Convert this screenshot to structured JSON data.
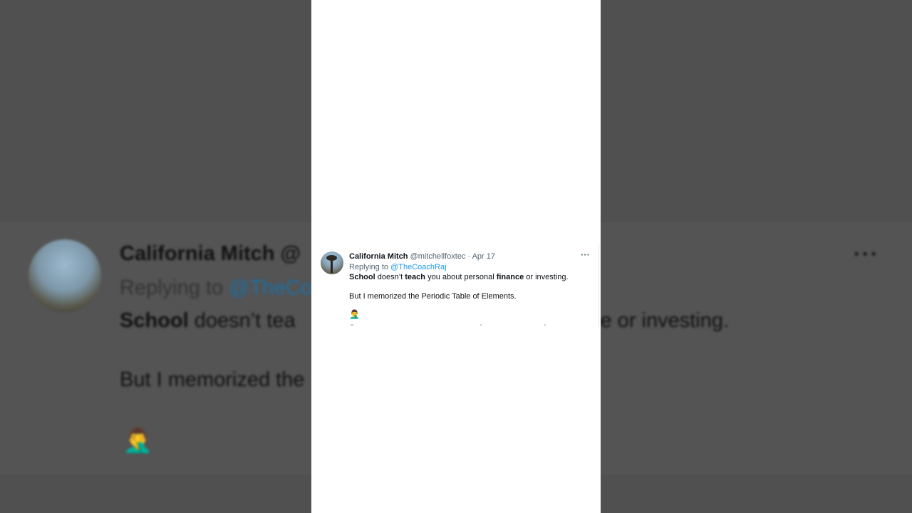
{
  "tweet": {
    "display_name": "California Mitch",
    "handle": "@mitchellfoxtec",
    "separator": " · ",
    "date": "Apr 17",
    "more_label": "···",
    "replying_prefix": "Replying to ",
    "replying_to": "@TheCoachRaj",
    "line1": {
      "w1": "School",
      "t1": " doesn’t ",
      "w2": "teach",
      "t2": " you about personal ",
      "w3": "finance",
      "t3": " or investing."
    },
    "line2": "But I memorized the Periodic Table of Elements.",
    "emoji": "🤦‍♂️"
  },
  "background": {
    "name_fragment": "California Mitch @",
    "reply_prefix": "Replying to ",
    "reply_fragment": "@TheCo",
    "line1_start_bold": "School",
    "line1_start_rest": " doesn’t tea",
    "line1_end": "ce or investing.",
    "line2_fragment": "But I memorized the",
    "more_label": "···"
  },
  "colors": {
    "link": "#1d9bf0",
    "text": "#0f1419",
    "muted": "#536471",
    "backdrop": "#4d4d4d"
  }
}
